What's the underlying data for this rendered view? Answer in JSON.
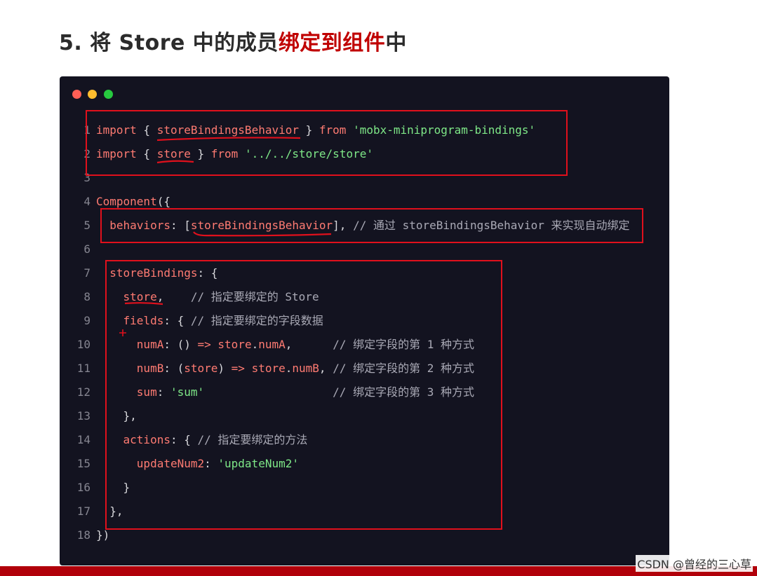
{
  "title": {
    "prefix": "5. 将 Store 中的成员",
    "highlight": "绑定到组件",
    "suffix": "中"
  },
  "colors": {
    "keyword": "#ff7b72",
    "string": "#7ee787",
    "comment": "#a9a9b5",
    "plain": "#d8d8dc",
    "annotation": "#e0101c",
    "highlight": "#c00000"
  },
  "code": {
    "line_numbers": [
      "1",
      "2",
      "3",
      "4",
      "5",
      "6",
      "7",
      "8",
      "9",
      "10",
      "11",
      "12",
      "13",
      "14",
      "15",
      "16",
      "17",
      "18"
    ],
    "lines": [
      [
        {
          "c": "kw",
          "t": "import"
        },
        {
          "c": "pl",
          "t": " { "
        },
        {
          "c": "kw",
          "t": "storeBindingsBehavior"
        },
        {
          "c": "pl",
          "t": " } "
        },
        {
          "c": "kw",
          "t": "from"
        },
        {
          "c": "pl",
          "t": " "
        },
        {
          "c": "str",
          "t": "'mobx-miniprogram-bindings'"
        }
      ],
      [
        {
          "c": "kw",
          "t": "import"
        },
        {
          "c": "pl",
          "t": " { "
        },
        {
          "c": "kw",
          "t": "store"
        },
        {
          "c": "pl",
          "t": " } "
        },
        {
          "c": "kw",
          "t": "from"
        },
        {
          "c": "pl",
          "t": " "
        },
        {
          "c": "str",
          "t": "'../../store/store'"
        }
      ],
      [],
      [
        {
          "c": "kw",
          "t": "Component"
        },
        {
          "c": "pl",
          "t": "({"
        }
      ],
      [
        {
          "c": "pl",
          "t": "  "
        },
        {
          "c": "kw",
          "t": "behaviors"
        },
        {
          "c": "pl",
          "t": ": ["
        },
        {
          "c": "kw",
          "t": "storeBindingsBehavior"
        },
        {
          "c": "pl",
          "t": "], "
        },
        {
          "c": "cm",
          "t": "// 通过 storeBindingsBehavior 来实现自动绑定"
        }
      ],
      [],
      [
        {
          "c": "pl",
          "t": "  "
        },
        {
          "c": "kw",
          "t": "storeBindings"
        },
        {
          "c": "pl",
          "t": ": {"
        }
      ],
      [
        {
          "c": "pl",
          "t": "    "
        },
        {
          "c": "kw",
          "t": "store"
        },
        {
          "c": "pl",
          "t": ",    "
        },
        {
          "c": "cm",
          "t": "// 指定要绑定的 Store"
        }
      ],
      [
        {
          "c": "pl",
          "t": "    "
        },
        {
          "c": "kw",
          "t": "fields"
        },
        {
          "c": "pl",
          "t": ": { "
        },
        {
          "c": "cm",
          "t": "// 指定要绑定的字段数据"
        }
      ],
      [
        {
          "c": "pl",
          "t": "      "
        },
        {
          "c": "kw",
          "t": "numA"
        },
        {
          "c": "pl",
          "t": ": () "
        },
        {
          "c": "kw",
          "t": "=>"
        },
        {
          "c": "pl",
          "t": " "
        },
        {
          "c": "kw",
          "t": "store"
        },
        {
          "c": "pl",
          "t": "."
        },
        {
          "c": "kw",
          "t": "numA"
        },
        {
          "c": "pl",
          "t": ",      "
        },
        {
          "c": "cm",
          "t": "// 绑定字段的第 1 种方式"
        }
      ],
      [
        {
          "c": "pl",
          "t": "      "
        },
        {
          "c": "kw",
          "t": "numB"
        },
        {
          "c": "pl",
          "t": ": ("
        },
        {
          "c": "kw",
          "t": "store"
        },
        {
          "c": "pl",
          "t": ") "
        },
        {
          "c": "kw",
          "t": "=>"
        },
        {
          "c": "pl",
          "t": " "
        },
        {
          "c": "kw",
          "t": "store"
        },
        {
          "c": "pl",
          "t": "."
        },
        {
          "c": "kw",
          "t": "numB"
        },
        {
          "c": "pl",
          "t": ", "
        },
        {
          "c": "cm",
          "t": "// 绑定字段的第 2 种方式"
        }
      ],
      [
        {
          "c": "pl",
          "t": "      "
        },
        {
          "c": "kw",
          "t": "sum"
        },
        {
          "c": "pl",
          "t": ": "
        },
        {
          "c": "str",
          "t": "'sum'"
        },
        {
          "c": "pl",
          "t": "                   "
        },
        {
          "c": "cm",
          "t": "// 绑定字段的第 3 种方式"
        }
      ],
      [
        {
          "c": "pl",
          "t": "    },"
        }
      ],
      [
        {
          "c": "pl",
          "t": "    "
        },
        {
          "c": "kw",
          "t": "actions"
        },
        {
          "c": "pl",
          "t": ": { "
        },
        {
          "c": "cm",
          "t": "// 指定要绑定的方法"
        }
      ],
      [
        {
          "c": "pl",
          "t": "      "
        },
        {
          "c": "kw",
          "t": "updateNum2"
        },
        {
          "c": "pl",
          "t": ": "
        },
        {
          "c": "str",
          "t": "'updateNum2'"
        }
      ],
      [
        {
          "c": "pl",
          "t": "    }"
        }
      ],
      [
        {
          "c": "pl",
          "t": "  },"
        }
      ],
      [
        {
          "c": "pl",
          "t": "})"
        }
      ]
    ]
  },
  "watermark": "CSDN @曾经的三心草"
}
